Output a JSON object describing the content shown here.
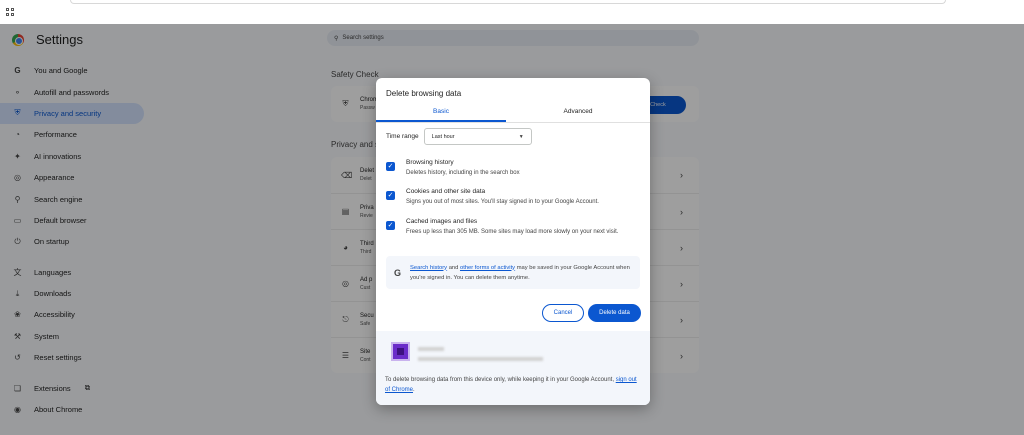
{
  "app": {
    "title": "Settings"
  },
  "search": {
    "placeholder": "Search settings"
  },
  "sidebar": {
    "items": [
      {
        "label": "You and Google",
        "icon": "google-g-icon"
      },
      {
        "label": "Autofill and passwords",
        "icon": "key-icon"
      },
      {
        "label": "Privacy and security",
        "icon": "shield-icon",
        "active": true
      },
      {
        "label": "Performance",
        "icon": "speedometer-icon"
      },
      {
        "label": "AI innovations",
        "icon": "sparkle-icon"
      },
      {
        "label": "Appearance",
        "icon": "palette-icon"
      },
      {
        "label": "Search engine",
        "icon": "search-icon"
      },
      {
        "label": "Default browser",
        "icon": "browser-icon"
      },
      {
        "label": "On startup",
        "icon": "power-icon"
      },
      {
        "label": "Languages",
        "icon": "translate-icon"
      },
      {
        "label": "Downloads",
        "icon": "download-icon"
      },
      {
        "label": "Accessibility",
        "icon": "accessibility-icon"
      },
      {
        "label": "System",
        "icon": "wrench-icon"
      },
      {
        "label": "Reset settings",
        "icon": "reset-icon"
      },
      {
        "label": "Extensions",
        "icon": "puzzle-icon"
      },
      {
        "label": "About Chrome",
        "icon": "chrome-icon"
      }
    ]
  },
  "main": {
    "safety_check_title": "Safety Check",
    "safety_row": {
      "t1": "Chrom",
      "t2": "Passw"
    },
    "safety_button": "ty Check",
    "privacy_title": "Privacy and s",
    "privacy_rows": [
      {
        "t1": "Delet",
        "t2": "Delet"
      },
      {
        "t1": "Priva",
        "t2": "Revie"
      },
      {
        "t1": "Third",
        "t2": "Third"
      },
      {
        "t1": "Ad p",
        "t2": "Cust"
      },
      {
        "t1": "Secu",
        "t2": "Safe"
      },
      {
        "t1": "Site",
        "t2": "Cont"
      }
    ]
  },
  "dialog": {
    "title": "Delete browsing data",
    "tabs": {
      "basic": "Basic",
      "advanced": "Advanced"
    },
    "time_range_label": "Time range",
    "time_range_value": "Last hour",
    "options": [
      {
        "title": "Browsing history",
        "desc": "Deletes history, including in the search box",
        "checked": true
      },
      {
        "title": "Cookies and other site data",
        "desc": "Signs you out of most sites. You'll stay signed in to your Google Account.",
        "checked": true
      },
      {
        "title": "Cached images and files",
        "desc": "Frees up less than 305 MB. Some sites may load more slowly on your next visit.",
        "checked": true
      }
    ],
    "info": {
      "link1": "Search history",
      "and": " and ",
      "link2": "other forms of activity",
      "rest": " may be saved in your Google Account when you're signed in. You can delete them anytime."
    },
    "cancel_label": "Cancel",
    "delete_label": "Delete data",
    "footer": {
      "text": "To delete browsing data from this device only, while keeping it in your Google Account, ",
      "link": "sign out of Chrome",
      "end": "."
    }
  },
  "colors": {
    "accent": "#0b57d0",
    "active_nav_bg": "#d3e3fd",
    "avatar": "#6a2cc9"
  }
}
